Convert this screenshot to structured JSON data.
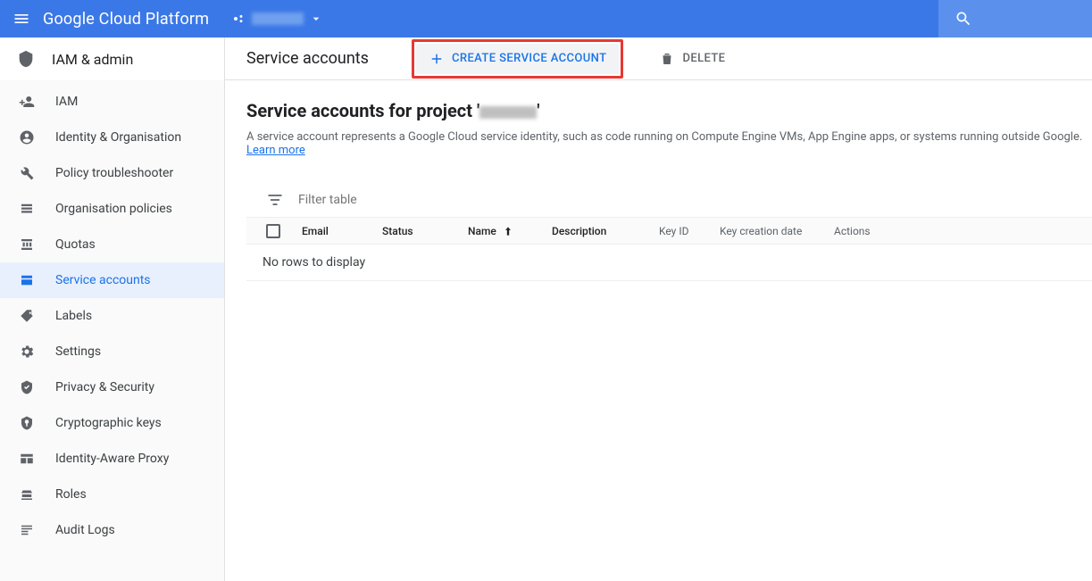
{
  "topbar": {
    "brand": "Google Cloud Platform",
    "project_name": "(redacted)"
  },
  "sidebar": {
    "section": "IAM & admin",
    "items": [
      {
        "icon": "person-add",
        "label": "IAM"
      },
      {
        "icon": "account-circle",
        "label": "Identity & Organisation"
      },
      {
        "icon": "wrench",
        "label": "Policy troubleshooter"
      },
      {
        "icon": "list",
        "label": "Organisation policies"
      },
      {
        "icon": "quota",
        "label": "Quotas"
      },
      {
        "icon": "service-account",
        "label": "Service accounts"
      },
      {
        "icon": "tag",
        "label": "Labels"
      },
      {
        "icon": "gear",
        "label": "Settings"
      },
      {
        "icon": "shield-check",
        "label": "Privacy & Security"
      },
      {
        "icon": "shield-key",
        "label": "Cryptographic keys"
      },
      {
        "icon": "iap",
        "label": "Identity-Aware Proxy"
      },
      {
        "icon": "roles",
        "label": "Roles"
      },
      {
        "icon": "audit",
        "label": "Audit Logs"
      }
    ],
    "active_index": 5
  },
  "toolbar": {
    "title": "Service accounts",
    "create_label": "CREATE SERVICE ACCOUNT",
    "delete_label": "DELETE"
  },
  "page": {
    "heading_prefix": "Service accounts for project '",
    "heading_suffix": "'",
    "description": "A service account represents a Google Cloud service identity, such as code running on Compute Engine VMs, App Engine apps, or systems running outside Google. ",
    "learn_more": "Learn more"
  },
  "table": {
    "filter_placeholder": "Filter table",
    "columns": {
      "email": "Email",
      "status": "Status",
      "name": "Name",
      "description": "Description",
      "key_id": "Key ID",
      "key_date": "Key creation date",
      "actions": "Actions"
    },
    "empty": "No rows to display"
  }
}
